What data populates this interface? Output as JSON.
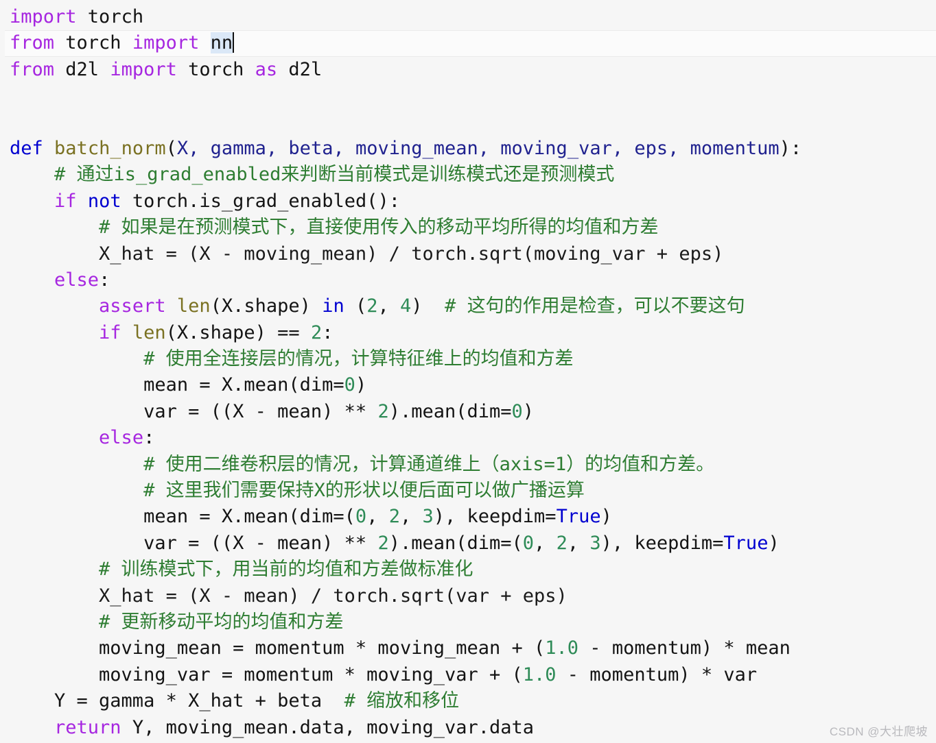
{
  "editor": {
    "language": "python",
    "theme": "light",
    "background_color": "#f6f6f6",
    "current_line_number": 2,
    "colors": {
      "keyword_purple": "#a626e0",
      "keyword_blue": "#0000d0",
      "function_olive": "#7a7122",
      "param_blue": "#20228f",
      "number_green": "#2e8b57",
      "comment_green": "#2e7d32",
      "plain_text": "#141414",
      "selection": "#dbe8f7",
      "current_line_bg": "#fbfbfb"
    }
  },
  "code": {
    "line1": {
      "kw_import": "import",
      "module": " torch"
    },
    "line2": {
      "kw_from": "from",
      "module": " torch ",
      "kw_import": "import",
      "space": " ",
      "selected": "nn"
    },
    "line3": {
      "kw_from": "from",
      "module": " d2l ",
      "kw_import": "import",
      "target": " torch ",
      "kw_as": "as",
      "alias": " d2l"
    },
    "line5": {
      "kw_def": "def",
      "space": " ",
      "fn_name": "batch_norm",
      "paren_open": "(",
      "params": "X, gamma, beta, moving_mean, moving_var, eps, momentum",
      "paren_close": "):"
    },
    "line6_comment": "    # 通过is_grad_enabled来判断当前模式是训练模式还是预测模式",
    "line7": {
      "indent": "    ",
      "kw_if": "if",
      "space1": " ",
      "kw_not": "not",
      "rest": " torch.is_grad_enabled():"
    },
    "line8_comment": "        # 如果是在预测模式下，直接使用传入的移动平均所得的均值和方差",
    "line9": "        X_hat = (X - moving_mean) / torch.sqrt(moving_var + eps)",
    "line10": {
      "indent": "    ",
      "kw_else": "else",
      "colon": ":"
    },
    "line11": {
      "indent": "        ",
      "kw_assert": "assert",
      "space": " ",
      "fn_len": "len",
      "args": "(X.shape) ",
      "kw_in": "in",
      "tuple_open": " (",
      "num_2": "2",
      "comma": ", ",
      "num_4": "4",
      "tuple_close": ")",
      "comment": "  # 这句的作用是检查，可以不要这句"
    },
    "line12": {
      "indent": "        ",
      "kw_if": "if",
      "space": " ",
      "fn_len": "len",
      "args": "(X.shape) == ",
      "num_2": "2",
      "colon": ":"
    },
    "line13_comment": "            # 使用全连接层的情况，计算特征维上的均值和方差",
    "line14": {
      "code": "            mean = X.mean(dim=",
      "num_0": "0",
      "tail": ")"
    },
    "line15": {
      "code": "            var = ((X - mean) ** ",
      "num_2": "2",
      "mid": ").mean(dim=",
      "num_0": "0",
      "tail": ")"
    },
    "line16": {
      "indent": "        ",
      "kw_else": "else",
      "colon": ":"
    },
    "line17_comment": "            # 使用二维卷积层的情况，计算通道维上（axis=1）的均值和方差。",
    "line18_comment": "            # 这里我们需要保持X的形状以便后面可以做广播运算",
    "line19": {
      "code": "            mean = X.mean(dim=(",
      "num_0": "0",
      "sep1": ", ",
      "num_2": "2",
      "sep2": ", ",
      "num_3": "3",
      "mid": "), keepdim=",
      "kw_true": "True",
      "tail": ")"
    },
    "line20": {
      "code": "            var = ((X - mean) ** ",
      "num_2a": "2",
      "mid1": ").mean(dim=(",
      "num_0": "0",
      "sep1": ", ",
      "num_2b": "2",
      "sep2": ", ",
      "num_3": "3",
      "mid2": "), keepdim=",
      "kw_true": "True",
      "tail": ")"
    },
    "line21_comment": "        # 训练模式下，用当前的均值和方差做标准化",
    "line22": "        X_hat = (X - mean) / torch.sqrt(var + eps)",
    "line23_comment": "        # 更新移动平均的均值和方差",
    "line24": {
      "pre": "        moving_mean = momentum * moving_mean + (",
      "num": "1.0",
      "post": " - momentum) * mean"
    },
    "line25": {
      "pre": "        moving_var = momentum * moving_var + (",
      "num": "1.0",
      "post": " - momentum) * var"
    },
    "line26": {
      "code": "    Y = gamma * X_hat + beta",
      "comment": "  # 缩放和移位"
    },
    "line27": {
      "indent": "    ",
      "kw_return": "return",
      "rest": " Y, moving_mean.data, moving_var.data"
    }
  },
  "watermark": {
    "text": "CSDN @大壮爬坡"
  }
}
